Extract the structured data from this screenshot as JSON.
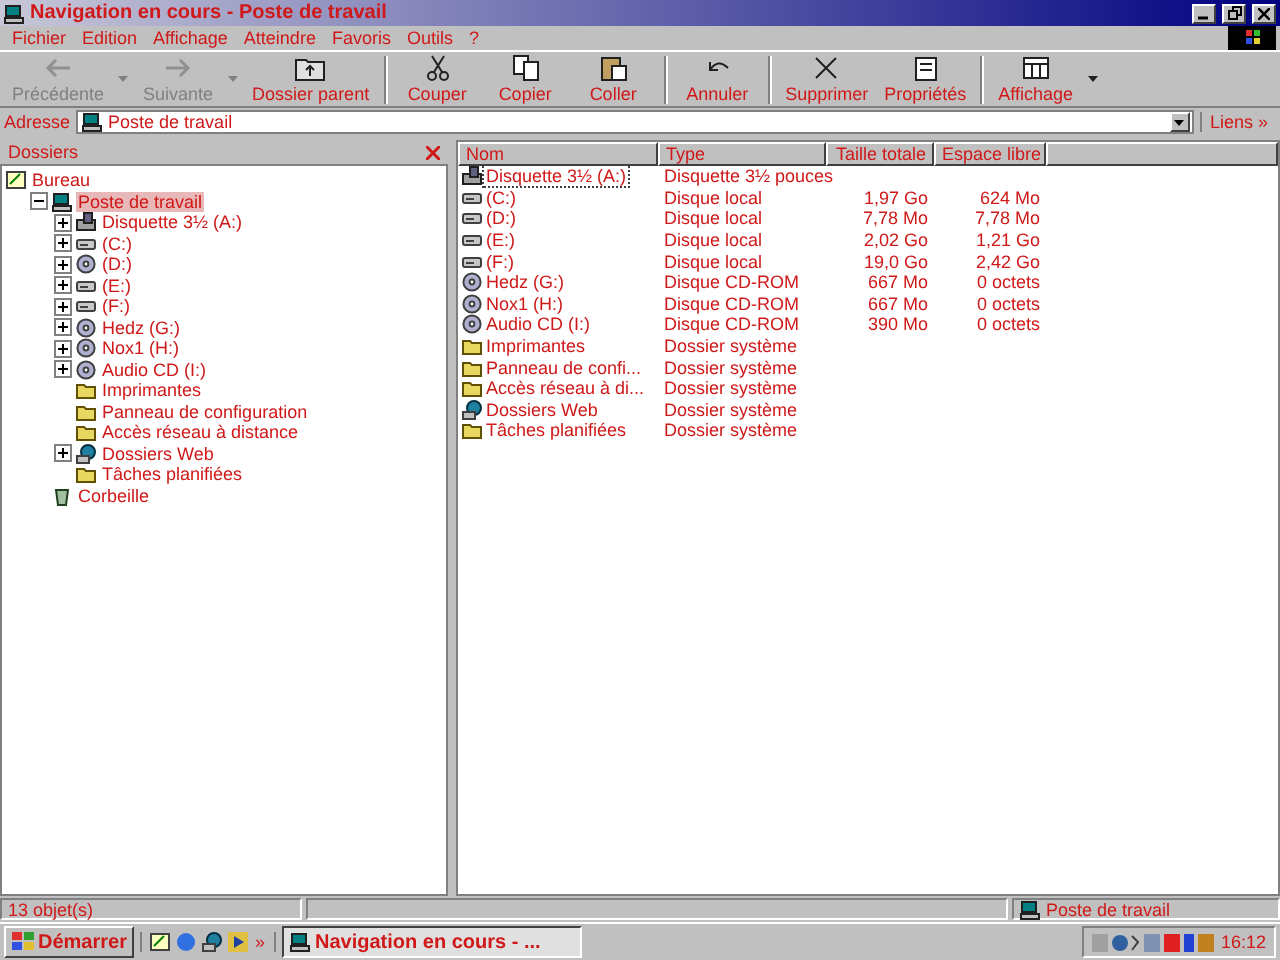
{
  "window": {
    "title": "Navigation en cours - Poste de travail"
  },
  "menu": [
    "Fichier",
    "Edition",
    "Affichage",
    "Atteindre",
    "Favoris",
    "Outils",
    "?"
  ],
  "toolbar": [
    {
      "label": "Précédente",
      "kind": "back",
      "disabled": true,
      "dropdown": true
    },
    {
      "label": "Suivante",
      "kind": "forward",
      "disabled": true,
      "dropdown": true
    },
    {
      "label": "Dossier parent",
      "kind": "up",
      "disabled": false,
      "dropdown": false
    },
    {
      "label": "Couper",
      "kind": "cut",
      "disabled": false,
      "dropdown": false
    },
    {
      "label": "Copier",
      "kind": "copy",
      "disabled": false,
      "dropdown": false
    },
    {
      "label": "Coller",
      "kind": "paste",
      "disabled": false,
      "dropdown": false
    },
    {
      "label": "Annuler",
      "kind": "undo",
      "disabled": false,
      "dropdown": false
    },
    {
      "label": "Supprimer",
      "kind": "delete",
      "disabled": false,
      "dropdown": false
    },
    {
      "label": "Propriétés",
      "kind": "properties",
      "disabled": false,
      "dropdown": false
    },
    {
      "label": "Affichage",
      "kind": "views",
      "disabled": false,
      "dropdown": true
    }
  ],
  "address": {
    "label": "Adresse",
    "value": "Poste de travail",
    "links": "Liens",
    "links_more": "»"
  },
  "folders_pane": {
    "title": "Dossiers",
    "tree": [
      {
        "label": "Bureau",
        "kind": "desktop",
        "selected": false,
        "children": [
          {
            "label": "Poste de travail",
            "kind": "computer",
            "expanded": true,
            "selected": true,
            "children": [
              {
                "label": "Disquette 3½ (A:)",
                "kind": "floppy",
                "expanded": false,
                "selected": false
              },
              {
                "label": "(C:)",
                "kind": "drive",
                "expanded": false,
                "selected": false
              },
              {
                "label": "(D:)",
                "kind": "cdrom",
                "expanded": false,
                "selected": false
              },
              {
                "label": "(E:)",
                "kind": "drive",
                "expanded": false,
                "selected": false
              },
              {
                "label": "(F:)",
                "kind": "drive",
                "expanded": false,
                "selected": false
              },
              {
                "label": "Hedz (G:)",
                "kind": "cdrom",
                "expanded": false,
                "selected": false
              },
              {
                "label": "Nox1 (H:)",
                "kind": "cdrom",
                "expanded": false,
                "selected": false
              },
              {
                "label": "Audio CD (I:)",
                "kind": "cdrom",
                "expanded": false,
                "selected": false
              },
              {
                "label": "Imprimantes",
                "kind": "folder",
                "selected": false
              },
              {
                "label": "Panneau de configuration",
                "kind": "folder",
                "selected": false
              },
              {
                "label": "Accès réseau à distance",
                "kind": "folder",
                "selected": false
              },
              {
                "label": "Dossiers Web",
                "kind": "web",
                "expanded": false,
                "selected": false
              },
              {
                "label": "Tâches planifiées",
                "kind": "folder",
                "selected": false
              }
            ]
          },
          {
            "label": "Corbeille",
            "kind": "trash",
            "selected": false
          }
        ]
      }
    ]
  },
  "table": {
    "columns": [
      "Nom",
      "Type",
      "Taille totale",
      "Espace libre"
    ],
    "rows": [
      {
        "name": "Disquette 3½ (A:)",
        "kind": "floppy",
        "type": "Disquette 3½ pouces",
        "selected": true
      },
      {
        "name": "(C:)",
        "kind": "drive",
        "type": "Disque local",
        "total": "1,97 Go",
        "free": "624 Mo",
        "selected": false
      },
      {
        "name": "(D:)",
        "kind": "drive",
        "type": "Disque local",
        "total": "7,78 Mo",
        "free": "7,78 Mo",
        "selected": false
      },
      {
        "name": "(E:)",
        "kind": "drive",
        "type": "Disque local",
        "total": "2,02 Go",
        "free": "1,21 Go",
        "selected": false
      },
      {
        "name": "(F:)",
        "kind": "drive",
        "type": "Disque local",
        "total": "19,0 Go",
        "free": "2,42 Go",
        "selected": false
      },
      {
        "name": "Hedz (G:)",
        "kind": "cdrom",
        "type": "Disque CD-ROM",
        "total": "667 Mo",
        "free": "0 octets",
        "selected": false
      },
      {
        "name": "Nox1 (H:)",
        "kind": "cdrom",
        "type": "Disque CD-ROM",
        "total": "667 Mo",
        "free": "0 octets",
        "selected": false
      },
      {
        "name": "Audio CD (I:)",
        "kind": "cdrom",
        "type": "Disque CD-ROM",
        "total": "390 Mo",
        "free": "0 octets",
        "selected": false
      },
      {
        "name": "Imprimantes",
        "kind": "folder",
        "type": "Dossier système",
        "selected": false
      },
      {
        "name": "Panneau de confi...",
        "kind": "folder",
        "type": "Dossier système",
        "selected": false
      },
      {
        "name": "Accès réseau à di...",
        "kind": "folder",
        "type": "Dossier système",
        "selected": false
      },
      {
        "name": "Dossiers Web",
        "kind": "web",
        "type": "Dossier système",
        "selected": false
      },
      {
        "name": "Tâches planifiées",
        "kind": "folder",
        "type": "Dossier système",
        "selected": false
      }
    ]
  },
  "status_bar": {
    "count": "13 objet(s)",
    "location": "Poste de travail"
  },
  "taskbar": {
    "start": "Démarrer",
    "more": "»",
    "task": "Navigation en cours - ...",
    "clock": "16:12"
  }
}
